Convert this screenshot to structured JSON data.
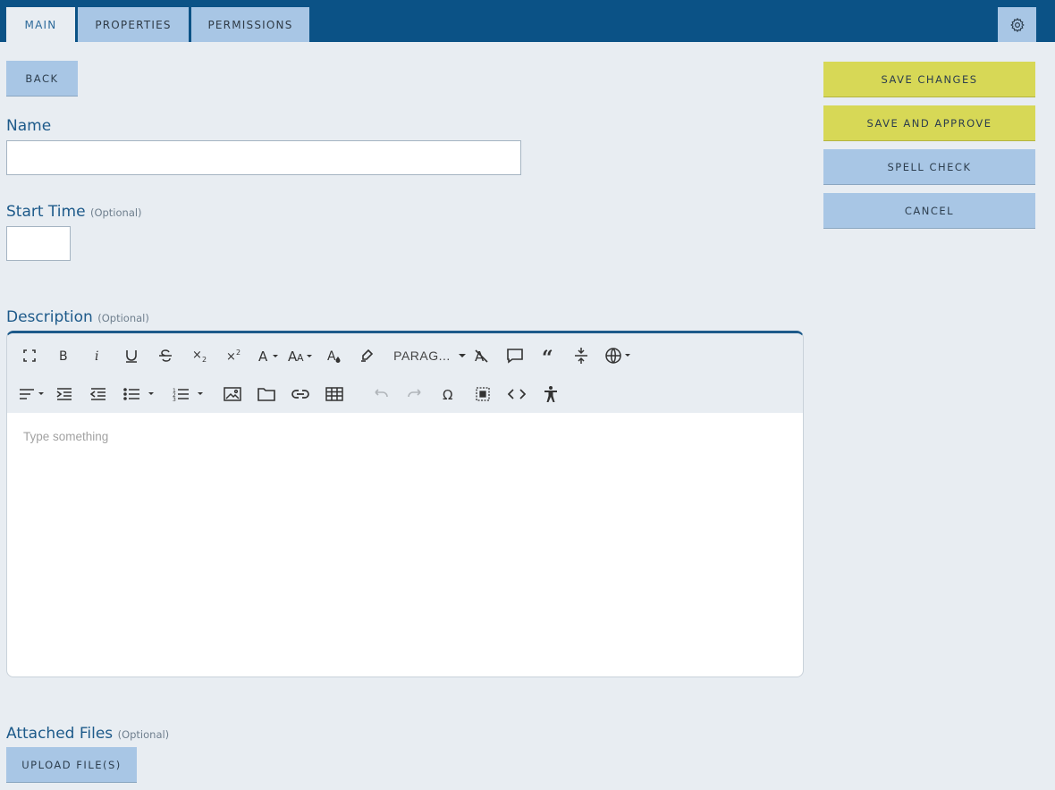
{
  "tabs": [
    {
      "label": "MAIN"
    },
    {
      "label": "PROPERTIES"
    },
    {
      "label": "PERMISSIONS"
    }
  ],
  "actions": {
    "back": "BACK",
    "save_changes": "SAVE CHANGES",
    "save_and_approve": "SAVE AND APPROVE",
    "spell_check": "SPELL CHECK",
    "cancel": "CANCEL",
    "upload": "UPLOAD FILE(S)"
  },
  "form": {
    "name_label": "Name",
    "name_value": "",
    "start_time_label": "Start Time",
    "start_time_value": "",
    "description_label": "Description",
    "attached_files_label": "Attached Files",
    "optional": "(Optional)"
  },
  "editor": {
    "paragraph_format": "PARAG...",
    "placeholder": "Type something"
  },
  "icons": [
    "gear-icon",
    "fullscreen-icon",
    "bold-icon",
    "italic-icon",
    "underline-icon",
    "strikethrough-icon",
    "subscript-icon",
    "superscript-icon",
    "font-family-icon",
    "font-size-icon",
    "text-color-icon",
    "highlight-icon",
    "clear-format-icon",
    "comment-icon",
    "quote-icon",
    "horizontal-line-icon",
    "language-icon",
    "align-icon",
    "indent-icon",
    "outdent-icon",
    "unordered-list-icon",
    "ordered-list-icon",
    "image-icon",
    "folder-icon",
    "link-icon",
    "table-icon",
    "undo-icon",
    "redo-icon",
    "special-char-icon",
    "select-all-icon",
    "code-view-icon",
    "accessibility-icon"
  ],
  "colors": {
    "topbar": "#0b5286",
    "tab": "#a8c6e5",
    "primary_action": "#d7d856",
    "background": "#e8edf2"
  }
}
